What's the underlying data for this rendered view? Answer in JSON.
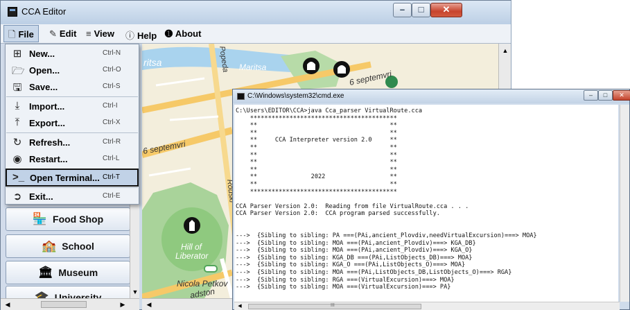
{
  "editor": {
    "title": "CCA Editor",
    "menu": [
      "File",
      "Edit",
      "View",
      "Help",
      "About"
    ],
    "file_menu": [
      {
        "label": "New...",
        "shortcut": "Ctrl-N",
        "icon": "new-file-icon"
      },
      {
        "label": "Open...",
        "shortcut": "Ctrl-O",
        "icon": "folder-icon"
      },
      {
        "label": "Save...",
        "shortcut": "Ctrl-S",
        "icon": "floppy-icon"
      },
      {
        "label": "Import...",
        "shortcut": "Ctrl-I",
        "icon": "import-icon"
      },
      {
        "label": "Export...",
        "shortcut": "Ctrl-X",
        "icon": "export-icon"
      },
      {
        "label": "Refresh...",
        "shortcut": "Ctrl-R",
        "icon": "refresh-icon"
      },
      {
        "label": "Restart...",
        "shortcut": "Ctrl-L",
        "icon": "restart-icon"
      },
      {
        "label": "Open Terminal...",
        "shortcut": "Ctrl-T",
        "icon": "terminal-icon",
        "highlighted": true
      },
      {
        "label": "Exit...",
        "shortcut": "Ctrl-E",
        "icon": "exit-icon"
      }
    ],
    "categories": [
      "Food Shop",
      "School",
      "Museum",
      "University"
    ],
    "map_labels": {
      "popeda": "Popeda",
      "ritsa": "ritsa",
      "maritsa": "Maritsa",
      "sept1": "6 septemvri",
      "sept2": "6 septemvri",
      "rouski": "Rouski",
      "hill1": "Hill of",
      "hill2": "Liberator",
      "petkov": "Nicola Petkov",
      "adston": "adston"
    }
  },
  "cmd": {
    "title": "C:\\Windows\\system32\\cmd.exe",
    "lines": [
      "C:\\Users\\EDITOR\\CCA>java Cca_parser VirtualRoute.cca",
      "    *****************************************",
      "    **                                     **",
      "    **                                     **",
      "    **     CCA Interpreter version 2.0     **",
      "    **                                     **",
      "    **                                     **",
      "    **                                     **",
      "    **                                     **",
      "    **               2022                  **",
      "    **                                     **",
      "    *****************************************",
      "",
      "CCA Parser Version 2.0:  Reading from file VirtualRoute.cca . . .",
      "CCA Parser Version 2.0:  CCA program parsed successfully.",
      "",
      "",
      "--->  {Sibling to sibling: PA ===(PAi,ancient_Plovdiv,needVirtualExcursion)===> MOA}",
      "--->  {Sibling to sibling: MOA ===(PAi,ancient_Plovdiv)===> KGA_DB}",
      "--->  {Sibling to sibling: MOA ===(PAi,ancient_Plovdiv)===> KGA_O}",
      "--->  {Sibling to sibling: KGA_DB ===(PAi,ListObjects_DB)===> MOA}",
      "--->  {Sibling to sibling: KGA_O ===(PAi,ListObjects_O)===> MOA}",
      "--->  {Sibling to sibling: MOA ===(PAi,ListObjects_DB,ListObjects_O)===> RGA}",
      "--->  {Sibling to sibling: RGA ===(VirtualExcursion)===> MOA}",
      "--->  {Sibling to sibling: MOA ===(VirtualExcursion)===> PA}"
    ],
    "hscroll_label": "III"
  }
}
